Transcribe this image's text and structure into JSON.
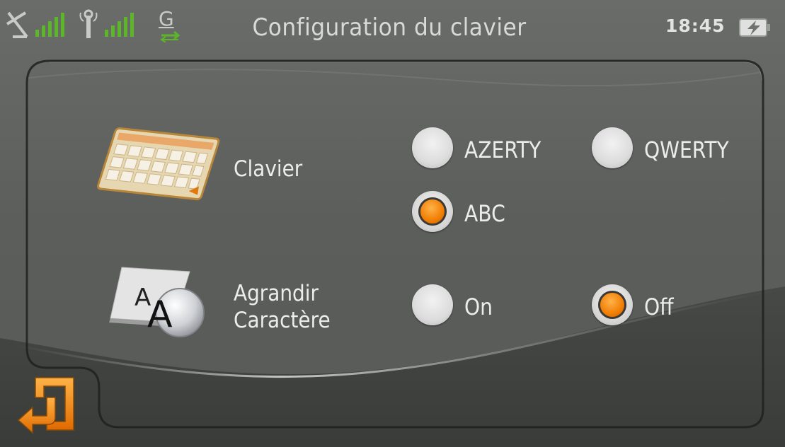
{
  "status_bar": {
    "title": "Configuration du clavier",
    "clock": "18:45",
    "network_letter": "G",
    "icons": [
      "satellite-signal-icon",
      "antenna-signal-icon",
      "gprs-icon",
      "battery-charging-icon"
    ]
  },
  "settings": {
    "keyboard": {
      "label": "Clavier",
      "icon": "keyboard-icon",
      "options": [
        {
          "label": "AZERTY",
          "selected": false
        },
        {
          "label": "QWERTY",
          "selected": false
        },
        {
          "label": "ABC",
          "selected": true
        }
      ]
    },
    "enlarge": {
      "label_line1": "Agrandir",
      "label_line2": "Caractère",
      "icon": "font-size-icon",
      "options": [
        {
          "label": "On",
          "selected": false
        },
        {
          "label": "Off",
          "selected": true
        }
      ]
    }
  },
  "colors": {
    "accent": "#f07c00",
    "signal": "#5db52a",
    "background": "#5e605e",
    "wave_dark": "#3f413f"
  },
  "back_button": {
    "icon": "back-arrow-icon"
  }
}
